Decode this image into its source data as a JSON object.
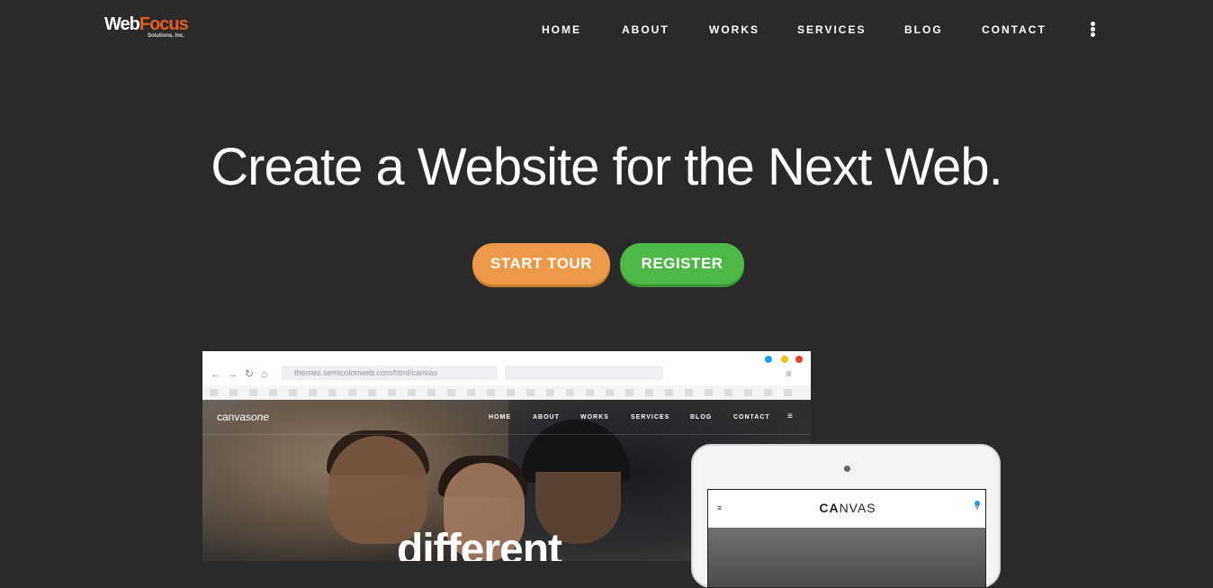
{
  "header": {
    "logo": {
      "part1": "Web",
      "part2": "Focus",
      "sub": "Solutions, Inc."
    },
    "nav": [
      "HOME",
      "ABOUT",
      "WORKS",
      "SERVICES",
      "BLOG",
      "CONTACT"
    ]
  },
  "hero": {
    "title": "Create a Website for the Next Web.",
    "buttons": {
      "tour": "START TOUR",
      "register": "REGISTER"
    }
  },
  "browser_mockup": {
    "address": "themes.semicolonweb.com/html/canvas",
    "site_logo": {
      "part1": "canvas",
      "part2": "one"
    },
    "nav": [
      "HOME",
      "ABOUT",
      "WORKS",
      "SERVICES",
      "BLOG",
      "CONTACT"
    ],
    "hero_word": "different"
  },
  "tablet_mockup": {
    "logo": {
      "part1": "CA",
      "part2": "NVAS"
    }
  },
  "colors": {
    "background": "#2a2a2a",
    "accent_orange": "#ec9a4a",
    "accent_green": "#4db846",
    "logo_orange": "#e55b1f"
  }
}
